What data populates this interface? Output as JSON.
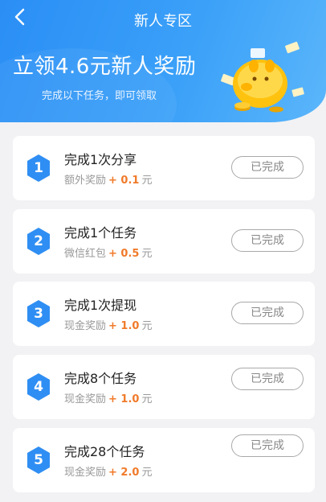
{
  "header": {
    "title": "新人专区",
    "hero": "立领4.6元新人奖励",
    "subtitle": "完成以下任务，即可领取"
  },
  "tasks": [
    {
      "num": "1",
      "name": "完成1次分享",
      "reward_label": "额外奖励",
      "amount": "+ 0.1",
      "unit": "元",
      "status": "已完成"
    },
    {
      "num": "2",
      "name": "完成1个任务",
      "reward_label": "微信红包",
      "amount": "+ 0.5",
      "unit": "元",
      "status": "已完成"
    },
    {
      "num": "3",
      "name": "完成1次提现",
      "reward_label": "现金奖励",
      "amount": "+ 1.0",
      "unit": "元",
      "status": "已完成"
    },
    {
      "num": "4",
      "name": "完成8个任务",
      "reward_label": "现金奖励",
      "amount": "+ 1.0",
      "unit": "元",
      "status": "已完成"
    },
    {
      "num": "5",
      "name": "完成28个任务",
      "reward_label": "现金奖励",
      "amount": "+ 2.0",
      "unit": "元",
      "status": "已完成"
    }
  ],
  "colors": {
    "header": "#2a8ef5",
    "hex_badge": "#2f8ef3",
    "amount": "#f07a2a",
    "button_border": "#a9a9a9"
  },
  "icons": [
    "back-arrow-icon",
    "piggy-bank-icon",
    "hexagon-number-badge"
  ]
}
